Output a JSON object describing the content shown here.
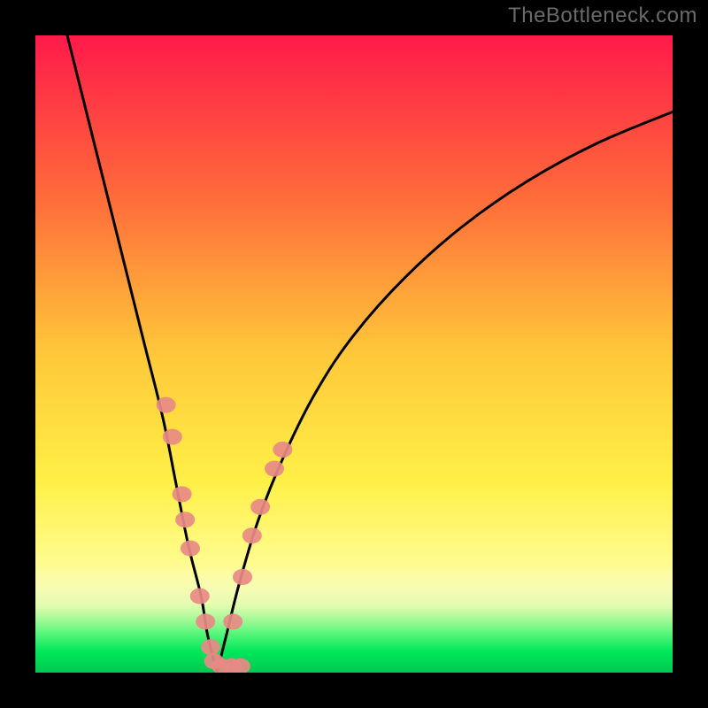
{
  "watermark": "TheBottleneck.com",
  "chart_data": {
    "type": "line",
    "title": "",
    "xlabel": "",
    "ylabel": "",
    "x_range": [
      0,
      100
    ],
    "y_range": [
      0,
      100
    ],
    "series": [
      {
        "name": "left-curve",
        "x": [
          5,
          8,
          11,
          14,
          17,
          20,
          22,
          24,
          26,
          27,
          28.5
        ],
        "y": [
          100,
          88,
          76,
          64,
          52,
          40,
          30,
          20,
          12,
          6,
          0
        ]
      },
      {
        "name": "right-curve",
        "x": [
          28.5,
          30,
          32,
          35,
          39,
          44,
          50,
          58,
          67,
          77,
          88,
          100
        ],
        "y": [
          0,
          6,
          14,
          24,
          34,
          44,
          53,
          62,
          70,
          77,
          83,
          88
        ]
      }
    ],
    "markers": {
      "name": "highlight-points",
      "color": "#e88a86",
      "points": [
        {
          "x": 20.5,
          "y": 42
        },
        {
          "x": 21.5,
          "y": 37
        },
        {
          "x": 23.0,
          "y": 28
        },
        {
          "x": 23.5,
          "y": 24
        },
        {
          "x": 24.3,
          "y": 19.5
        },
        {
          "x": 25.8,
          "y": 12
        },
        {
          "x": 26.7,
          "y": 8
        },
        {
          "x": 27.5,
          "y": 4
        },
        {
          "x": 28.0,
          "y": 1.8
        },
        {
          "x": 29.2,
          "y": 1.0
        },
        {
          "x": 30.8,
          "y": 1.0
        },
        {
          "x": 32.2,
          "y": 1.0
        },
        {
          "x": 31.0,
          "y": 8
        },
        {
          "x": 32.5,
          "y": 15
        },
        {
          "x": 34.0,
          "y": 21.5
        },
        {
          "x": 35.3,
          "y": 26
        },
        {
          "x": 37.5,
          "y": 32
        },
        {
          "x": 38.8,
          "y": 35
        }
      ]
    },
    "bottom_band": {
      "color_center": "#00ff5a",
      "y_center": 1.5,
      "fade_height": 14
    },
    "gradient": {
      "stops": [
        {
          "pos": 0.0,
          "color": "#ff1a4a"
        },
        {
          "pos": 0.25,
          "color": "#ff6a3a"
        },
        {
          "pos": 0.5,
          "color": "#ffc83a"
        },
        {
          "pos": 0.7,
          "color": "#fff047"
        },
        {
          "pos": 0.82,
          "color": "#fffb8a"
        },
        {
          "pos": 0.9,
          "color": "#fafcc0"
        },
        {
          "pos": 0.95,
          "color": "#b7f7a0"
        },
        {
          "pos": 1.0,
          "color": "#00ff5a"
        }
      ]
    }
  }
}
